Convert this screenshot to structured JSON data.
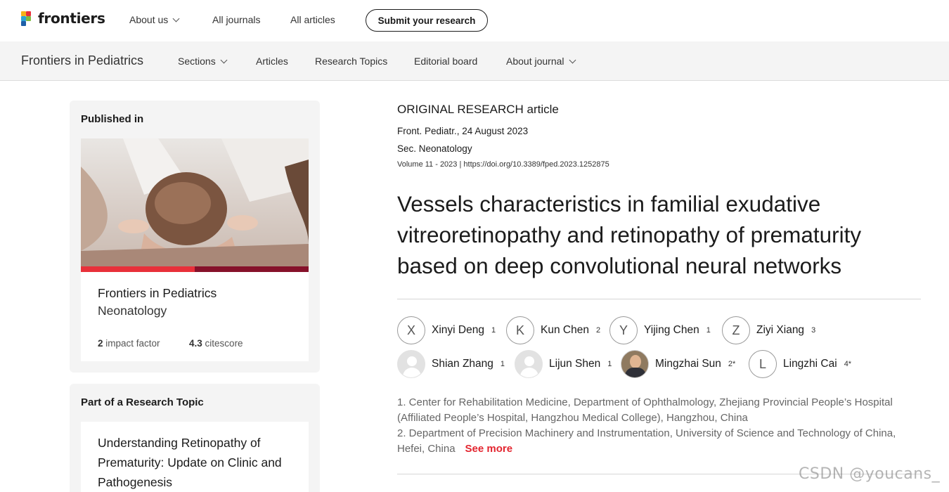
{
  "topnav": {
    "logo_text": "frontiers",
    "about_us": "About us",
    "all_journals": "All journals",
    "all_articles": "All articles",
    "submit": "Submit your research"
  },
  "journalnav": {
    "title": "Frontiers in Pediatrics",
    "sections": "Sections",
    "articles": "Articles",
    "research_topics": "Research Topics",
    "editorial_board": "Editorial board",
    "about_journal": "About journal"
  },
  "published_in": {
    "heading": "Published in",
    "journal": "Frontiers in Pediatrics",
    "section": "Neonatology",
    "impact_value": "2",
    "impact_label": "impact factor",
    "citescore_value": "4.3",
    "citescore_label": "citescore"
  },
  "research_topic": {
    "heading": "Part of a Research Topic",
    "title": "Understanding Retinopathy of Prematurity: Update on Clinic and Pathogenesis"
  },
  "article": {
    "type": "ORIGINAL RESEARCH article",
    "journal_date": "Front. Pediatr., 24 August 2023",
    "section": "Sec. Neonatology",
    "volume": "Volume 11 - 2023",
    "doi": "https://doi.org/10.3389/fped.2023.1252875",
    "title": "Vessels characteristics in familial exudative vitreoretinopathy and retinopathy of prematurity based on deep convolutional neural networks",
    "authors": [
      {
        "initial": "X",
        "name": "Xinyi Deng",
        "aff": "1"
      },
      {
        "initial": "K",
        "name": "Kun Chen",
        "aff": "2"
      },
      {
        "initial": "Y",
        "name": "Yijing Chen",
        "aff": "1"
      },
      {
        "initial": "Z",
        "name": "Ziyi Xiang",
        "aff": "3"
      },
      {
        "initial": "",
        "name": "Shian Zhang",
        "aff": "1"
      },
      {
        "initial": "",
        "name": "Lijun Shen",
        "aff": "1"
      },
      {
        "initial": "",
        "name": "Mingzhai Sun",
        "aff": "2*"
      },
      {
        "initial": "L",
        "name": "Lingzhi Cai",
        "aff": "4*"
      }
    ],
    "affiliation_1": "1. Center for Rehabilitation Medicine, Department of Ophthalmology, Zhejiang Provincial People’s Hospital (Affiliated People’s Hospital, Hangzhou Medical College), Hangzhou, China",
    "affiliation_2": "2. Department of Precision Machinery and Instrumentation, University of Science and Technology of China, Hefei, China",
    "see_more": "See more"
  },
  "watermark": "CSDN @youcans_",
  "colors": {
    "accent_red": "#e3252f",
    "bar_red": "#e8303a",
    "bar_dark": "#86112a"
  }
}
